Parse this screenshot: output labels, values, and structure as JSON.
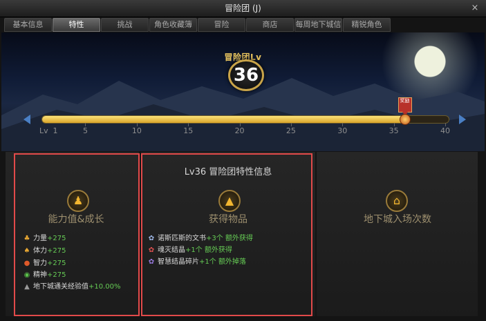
{
  "window": {
    "title": "冒险团 (J)",
    "close": "×"
  },
  "tabs": [
    {
      "label": "基本信息",
      "active": false
    },
    {
      "label": "特性",
      "active": true
    },
    {
      "label": "挑战",
      "active": false
    },
    {
      "label": "角色收藏簿",
      "active": false
    },
    {
      "label": "冒险",
      "active": false
    },
    {
      "label": "商店",
      "active": false
    },
    {
      "label": "每周地下城信息",
      "active": false
    },
    {
      "label": "精锐角色",
      "active": false
    }
  ],
  "level": {
    "label": "冒险团Lv",
    "value": "36",
    "current_progress": 36,
    "marker_label": "奖励"
  },
  "progress": {
    "prefix": "Lv",
    "ticks": [
      "1",
      "5",
      "10",
      "15",
      "20",
      "25",
      "30",
      "35",
      "40"
    ],
    "min": 1,
    "max": 40
  },
  "info_title": "Lv36  冒险团特性信息",
  "panel_stats": {
    "title": "能力值&成长",
    "icon": "golden-figure-icon",
    "items": [
      {
        "icon": "strength-icon",
        "label": "力量",
        "value": "+275"
      },
      {
        "icon": "stamina-icon",
        "label": "体力",
        "value": "+275"
      },
      {
        "icon": "intelligence-icon",
        "label": "智力",
        "value": "+275"
      },
      {
        "icon": "spirit-icon",
        "label": "精神",
        "value": "+275"
      },
      {
        "icon": "dungeon-exp-icon",
        "label": "地下城通关经验值",
        "value": "+10.00%"
      }
    ]
  },
  "panel_items": {
    "title": "获得物品",
    "icon": "treasure-pile-icon",
    "items": [
      {
        "icon": "scroll-icon",
        "label": "诺斯匹斯的文书",
        "value": "+3个",
        "note": "额外获得"
      },
      {
        "icon": "soul-crystal-icon",
        "label": "魂灭结晶",
        "value": "+1个",
        "note": "额外获得"
      },
      {
        "icon": "wisdom-shard-icon",
        "label": "智慧结晶碎片",
        "value": "+1个",
        "note": "额外掉落"
      }
    ]
  },
  "panel_dungeon": {
    "title": "地下城入场次数",
    "icon": "dungeon-gate-icon"
  }
}
